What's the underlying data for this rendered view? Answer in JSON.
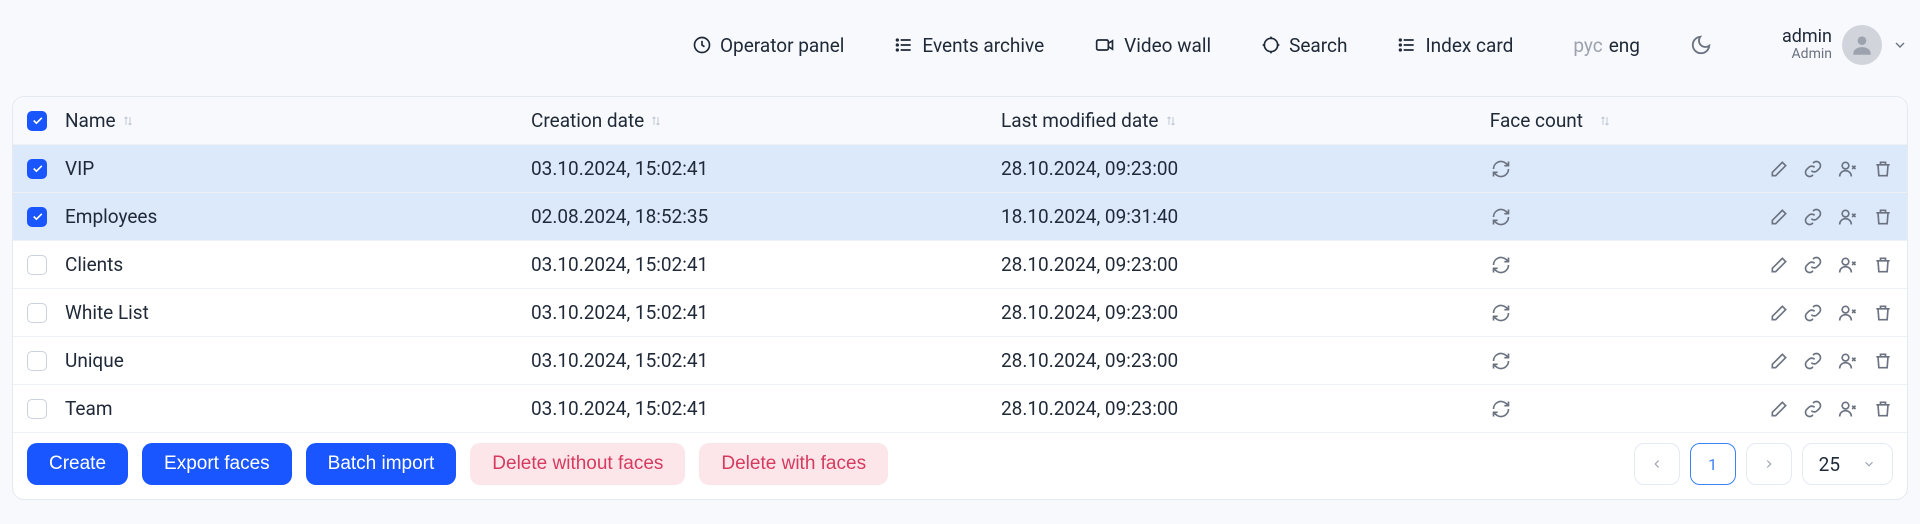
{
  "nav": {
    "operator_panel": "Operator panel",
    "events_archive": "Events archive",
    "video_wall": "Video wall",
    "search": "Search",
    "index_card": "Index card"
  },
  "lang": {
    "rus": "рус",
    "eng": "eng"
  },
  "user": {
    "name": "admin",
    "role": "Admin"
  },
  "table": {
    "head": {
      "name": "Name",
      "cdate": "Creation date",
      "mdate": "Last modified date",
      "count": "Face count"
    },
    "rows": [
      {
        "name": "VIP",
        "cdate": "03.10.2024, 15:02:41",
        "mdate": "28.10.2024, 09:23:00",
        "selected": true
      },
      {
        "name": "Employees",
        "cdate": "02.08.2024, 18:52:35",
        "mdate": "18.10.2024, 09:31:40",
        "selected": true
      },
      {
        "name": "Clients",
        "cdate": "03.10.2024, 15:02:41",
        "mdate": "28.10.2024, 09:23:00",
        "selected": false
      },
      {
        "name": "White List",
        "cdate": "03.10.2024, 15:02:41",
        "mdate": "28.10.2024, 09:23:00",
        "selected": false
      },
      {
        "name": "Unique",
        "cdate": "03.10.2024, 15:02:41",
        "mdate": "28.10.2024, 09:23:00",
        "selected": false
      },
      {
        "name": "Team",
        "cdate": "03.10.2024, 15:02:41",
        "mdate": "28.10.2024, 09:23:00",
        "selected": false
      }
    ]
  },
  "footer": {
    "create": "Create",
    "export": "Export faces",
    "batch": "Batch import",
    "del_without": "Delete without faces",
    "del_with": "Delete with faces",
    "page_current": "1",
    "page_size": "25"
  }
}
